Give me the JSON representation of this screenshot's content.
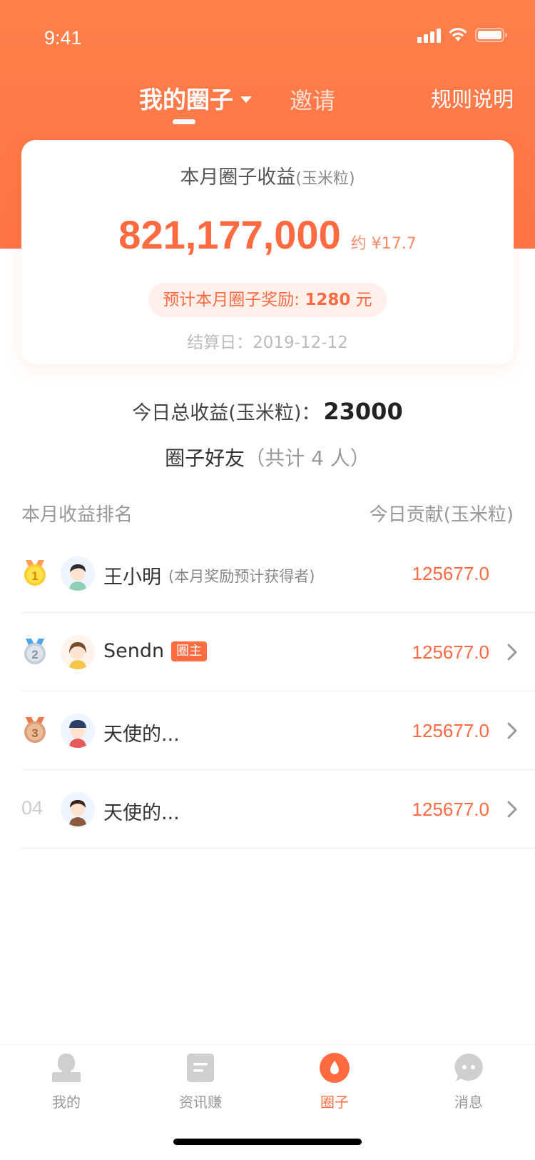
{
  "status_bar": {
    "time": "9:41"
  },
  "nav": {
    "tab_main": "我的圈子",
    "tab_invite": "邀请",
    "rules": "规则说明"
  },
  "card": {
    "title": "本月圈子收益",
    "title_unit": "(玉米粒)",
    "amount": "821,177,000",
    "approx": "约 ¥17.7",
    "reward_prefix": "预计本月圈子奖励: ",
    "reward_value": "1280",
    "reward_suffix": " 元",
    "settle_date": "结算日：2019-12-12"
  },
  "today": {
    "label": "今日总收益(玉米粒)：",
    "value": "23000"
  },
  "friends": {
    "title": "圈子好友",
    "count": "（共计 4 人）"
  },
  "list_header": {
    "left": "本月收益排名",
    "right": "今日贡献(玉米粒)"
  },
  "ranking": [
    {
      "rank": "1",
      "name": "王小明",
      "note": "(本月奖励预计获得者)",
      "badge": "",
      "value": "125677.0",
      "medal": "gold"
    },
    {
      "rank": "2",
      "name": "Sendn",
      "note": "",
      "badge": "圈主",
      "value": "125677.0",
      "medal": "silver"
    },
    {
      "rank": "3",
      "name": "天使的...",
      "note": "",
      "badge": "",
      "value": "125677.0",
      "medal": "bronze"
    },
    {
      "rank": "04",
      "name": "天使的...",
      "note": "",
      "badge": "",
      "value": "125677.0",
      "medal": ""
    }
  ],
  "tabbar": {
    "items": [
      {
        "label": "我的",
        "icon": "person-icon"
      },
      {
        "label": "资讯赚",
        "icon": "news-icon"
      },
      {
        "label": "圈子",
        "icon": "circle-drop-icon"
      },
      {
        "label": "消息",
        "icon": "chat-icon"
      }
    ],
    "active": 2
  },
  "colors": {
    "primary": "#ff6a40",
    "header": "#ff7a48",
    "muted": "#999999"
  }
}
